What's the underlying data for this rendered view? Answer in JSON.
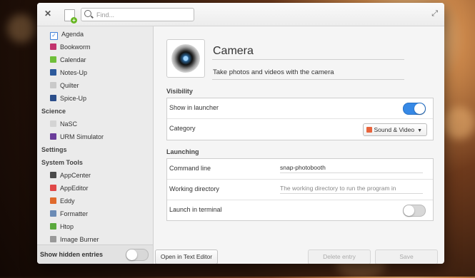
{
  "search": {
    "placeholder": "Find..."
  },
  "sidebar": {
    "groups": [
      {
        "items": [
          {
            "label": "Agenda",
            "icon": "agenda-icon",
            "color": "#3d7fd9"
          },
          {
            "label": "Bookworm",
            "icon": "bookworm-icon",
            "color": "#c2336d"
          },
          {
            "label": "Calendar",
            "icon": "calendar-icon",
            "color": "#6fbf3a"
          },
          {
            "label": "Notes-Up",
            "icon": "notes-up-icon",
            "color": "#2d5a9c"
          },
          {
            "label": "Quilter",
            "icon": "quilter-icon",
            "color": "#c9c9c9"
          },
          {
            "label": "Spice-Up",
            "icon": "spice-up-icon",
            "color": "#2b4e8a"
          }
        ]
      },
      {
        "category": "Science",
        "items": [
          {
            "label": "NaSC",
            "icon": "nasc-icon",
            "color": "#d4d4d4"
          },
          {
            "label": "URM Simulator",
            "icon": "urm-simulator-icon",
            "color": "#6a3d9a"
          }
        ]
      },
      {
        "category": "Settings",
        "items": []
      },
      {
        "category": "System Tools",
        "items": [
          {
            "label": "AppCenter",
            "icon": "appcenter-icon",
            "color": "#4a4a4a"
          },
          {
            "label": "AppEditor",
            "icon": "appeditor-icon",
            "color": "#e04848"
          },
          {
            "label": "Eddy",
            "icon": "eddy-icon",
            "color": "#e06a2c"
          },
          {
            "label": "Formatter",
            "icon": "formatter-icon",
            "color": "#6b8bb5"
          },
          {
            "label": "Htop",
            "icon": "htop-icon",
            "color": "#59a83c"
          },
          {
            "label": "Image Burner",
            "icon": "image-burner-icon",
            "color": "#999999"
          }
        ]
      }
    ],
    "footer": {
      "label": "Show hidden entries",
      "toggle_on": false
    }
  },
  "entry": {
    "name": "Camera",
    "comment": "Take photos and videos with the camera",
    "icon": "camera-app-icon"
  },
  "visibility": {
    "title": "Visibility",
    "show_in_launcher": {
      "label": "Show in launcher",
      "on": true
    },
    "category": {
      "label": "Category",
      "value": "Sound & Video"
    }
  },
  "launching": {
    "title": "Launching",
    "command_line": {
      "label": "Command line",
      "value": "snap-photobooth"
    },
    "working_directory": {
      "label": "Working directory",
      "placeholder": "The working directory to run the program in"
    },
    "launch_in_terminal": {
      "label": "Launch in terminal",
      "on": false
    }
  },
  "actions": {
    "open_text_editor": "Open in Text Editor",
    "delete_entry": "Delete entry",
    "save": "Save"
  },
  "colors": {
    "accent": "#3689e6"
  }
}
